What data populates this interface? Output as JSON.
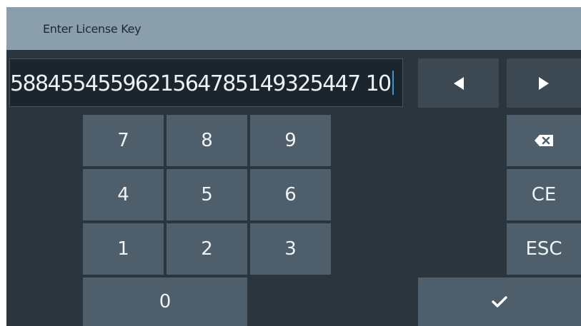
{
  "dialog": {
    "title": "Enter License Key"
  },
  "input": {
    "value": "5884554559621564785149325447 10"
  },
  "keypad": {
    "k7": "7",
    "k8": "8",
    "k9": "9",
    "k4": "4",
    "k5": "5",
    "k6": "6",
    "k1": "1",
    "k2": "2",
    "k3": "3",
    "k0": "0"
  },
  "actions": {
    "ce": "CE",
    "esc": "ESC"
  },
  "icons": {
    "left": "left-arrow-icon",
    "right": "right-arrow-icon",
    "backspace": "backspace-icon",
    "enter": "checkmark-icon"
  },
  "colors": {
    "title_bar": "#8a9fab",
    "background": "#2b353e",
    "key": "#4e5e6a",
    "caret": "#3b94d6"
  }
}
